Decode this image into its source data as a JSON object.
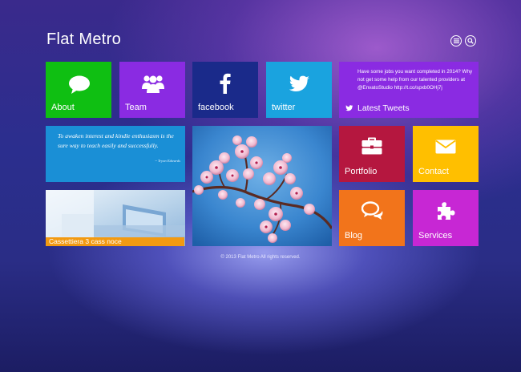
{
  "header": {
    "logo": "Flat Metro",
    "menu_icon": "menu-icon",
    "search_icon": "search-icon"
  },
  "tiles": {
    "about": {
      "label": "About",
      "icon": "speech-bubble-icon",
      "color": "#0fbf12"
    },
    "team": {
      "label": "Team",
      "icon": "people-icon",
      "color": "#8a2be2"
    },
    "facebook": {
      "label": "facebook",
      "icon": "facebook-icon",
      "color": "#1a2a8a"
    },
    "twitter": {
      "label": "twitter",
      "icon": "twitter-icon",
      "color": "#1aa3df"
    },
    "tweets": {
      "text": "Have some jobs you want completed in 2014? Why not get some help from our talented providers at @EnvatoStudio http://t.co/spxb0OHj7j",
      "label": "Latest Tweets",
      "icon": "twitter-bird-icon",
      "color": "#8a2be2"
    },
    "quote": {
      "text": "To awaken interest and kindle enthusiasm is the sure way to teach easily and successfully.",
      "author": "~ Tryon Edwards",
      "color": "#1a8fd6"
    },
    "photo_tile": {
      "caption": "Cassettiera 3 cass noce",
      "caption_color": "#f29a12"
    },
    "portfolio": {
      "label": "Portfolio",
      "icon": "briefcase-icon",
      "color": "#b5173f"
    },
    "contact": {
      "label": "Contact",
      "icon": "envelope-icon",
      "color": "#ffbf00"
    },
    "blog": {
      "label": "Blog",
      "icon": "chat-bubbles-icon",
      "color": "#f2741b"
    },
    "services": {
      "label": "Services",
      "icon": "puzzle-icon",
      "color": "#c727d4"
    }
  },
  "footer": {
    "text": "© 2013 Flat Metro All rights reserved."
  }
}
